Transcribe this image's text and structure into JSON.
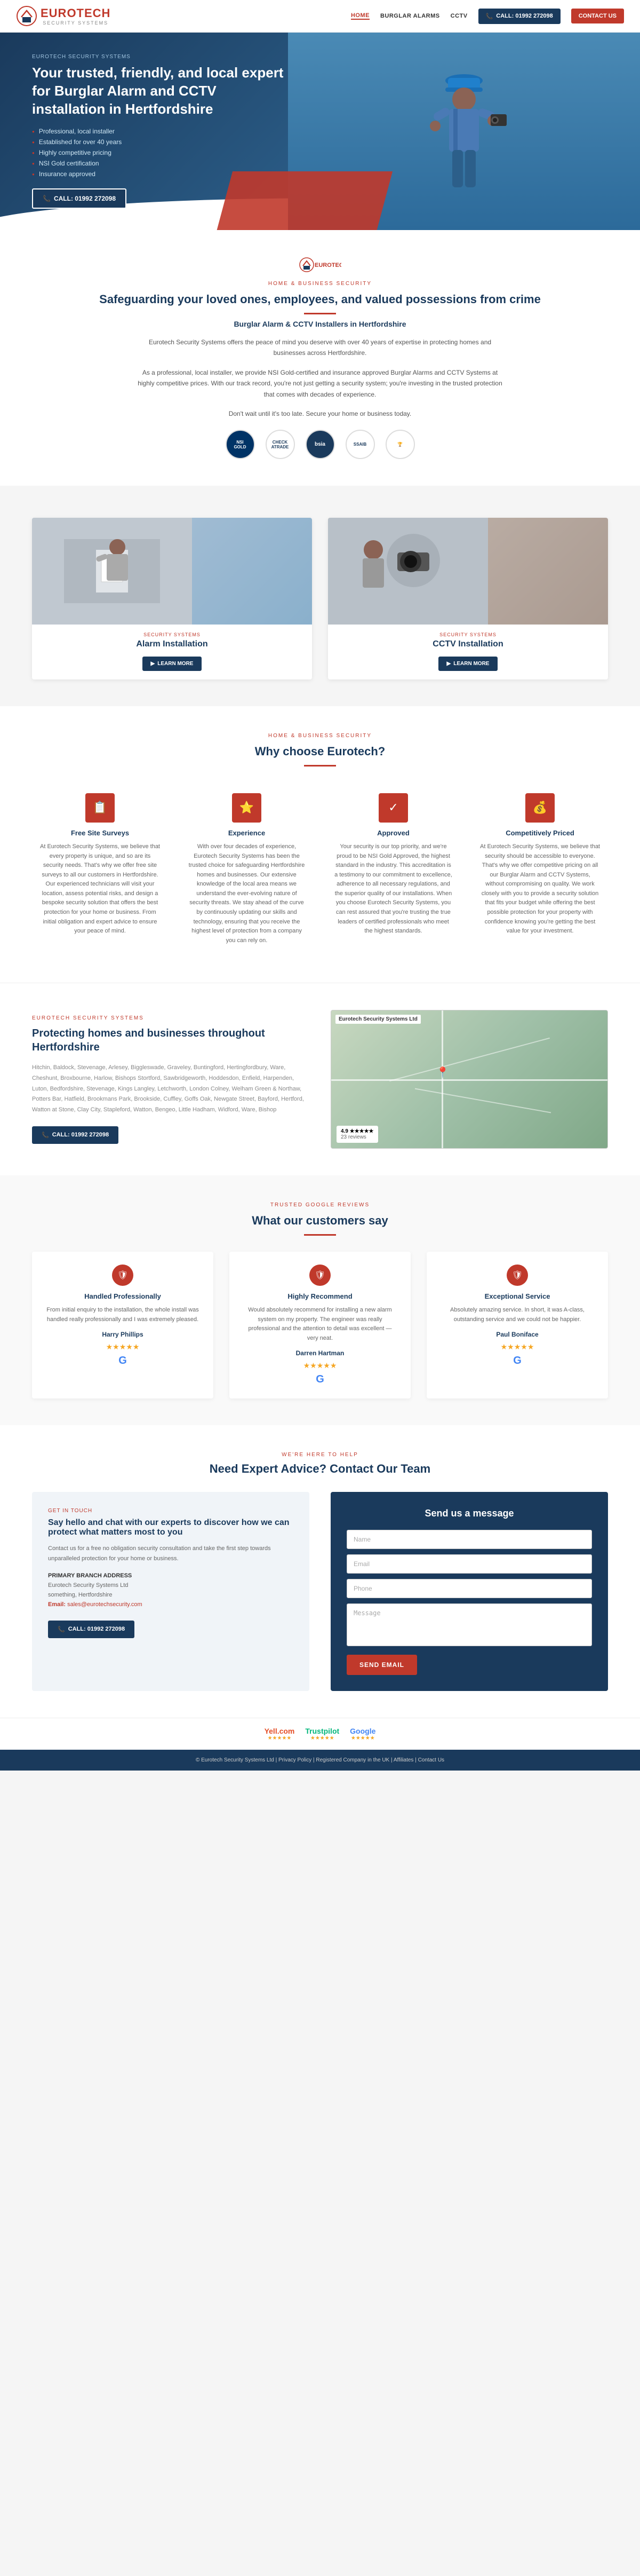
{
  "header": {
    "logo": "EUROTECH",
    "logo_tagline": "SECURITY SYSTEMS",
    "nav": {
      "home": "HOME",
      "burglar_alarms": "BURGLAR ALARMS",
      "cctv": "CCTV",
      "phone_label": "CALL: 01992 272098",
      "contact_label": "CONTACT US"
    }
  },
  "hero": {
    "label": "EUROTECH SECURITY SYSTEMS",
    "title": "Your trusted, friendly, and local expert for Burglar Alarm and CCTV installation in Hertfordshire",
    "features": [
      "Professional, local installer",
      "Established for over 40 years",
      "Highly competitive pricing",
      "NSI Gold certification",
      "Insurance approved"
    ],
    "cta": "CALL: 01992 272098"
  },
  "about": {
    "label": "HOME & BUSINESS SECURITY",
    "title": "Safeguarding your loved ones, employees, and valued possessions from crime",
    "subtitle": "Burglar Alarm & CCTV Installers in Hertfordshire",
    "text1": "Eurotech Security Systems offers the peace of mind you deserve with over 40 years of expertise in protecting homes and businesses across Hertfordshire.",
    "text2": "As a professional, local installer, we provide NSI Gold-certified and insurance approved Burglar Alarms and CCTV Systems at highly competitive prices. With our track record, you're not just getting a security system; you're investing in the trusted protection that comes with decades of experience.",
    "text3": "Don't wait until it's too late. Secure your home or business today."
  },
  "services": {
    "card1": {
      "label": "SECURITY SYSTEMS",
      "title": "Alarm Installation",
      "btn": "LEARN MORE"
    },
    "card2": {
      "label": "SECURITY SYSTEMS",
      "title": "CCTV Installation",
      "btn": "LEARN MORE"
    }
  },
  "why": {
    "label": "HOME & BUSINESS SECURITY",
    "title": "Why choose Eurotech?",
    "cards": [
      {
        "icon": "📋",
        "title": "Free Site Surveys",
        "text": "At Eurotech Security Systems, we believe that every property is unique, and so are its security needs. That's why we offer free site surveys to all our customers in Hertfordshire. Our experienced technicians will visit your location, assess potential risks, and design a bespoke security solution that offers the best protection for your home or business. From initial obligation and expert advice to ensure your peace of mind."
      },
      {
        "icon": "⭐",
        "title": "Experience",
        "text": "With over four decades of experience, Eurotech Security Systems has been the trusted choice for safeguarding Hertfordshire homes and businesses. Our extensive knowledge of the local area means we understand the ever-evolving nature of security threats. We stay ahead of the curve by continuously updating our skills and technology, ensuring that you receive the highest level of protection from a company you can rely on."
      },
      {
        "icon": "✓",
        "title": "Approved",
        "text": "Your security is our top priority, and we're proud to be NSI Gold Approved, the highest standard in the industry. This accreditation is a testimony to our commitment to excellence, adherence to all necessary regulations, and the superior quality of our installations. When you choose Eurotech Security Systems, you can rest assured that you're trusting the true leaders of certified professionals who meet the highest standards."
      },
      {
        "icon": "💰",
        "title": "Competitively Priced",
        "text": "At Eurotech Security Systems, we believe that security should be accessible to everyone. That's why we offer competitive pricing on all our Burglar Alarm and CCTV Systems, without compromising on quality. We work closely with you to provide a security solution that fits your budget while offering the best possible protection for your property with confidence knowing you're getting the best value for your investment."
      }
    ]
  },
  "locations": {
    "label": "EUROTECH SECURITY SYSTEMS",
    "title": "Protecting homes and businesses throughout Hertfordshire",
    "areas": "Hitchin, Baldock, Stevenage, Arlesey, Biggleswade, Graveley, Buntingford, Hertingfordbury, Ware, Cheshunt, Broxbourne, Harlow, Bishops Stortford, Sawbridgeworth, Hoddesdon, Enfield, Harpenden, Luton, Bedfordshire, Stevenage, Kings Langley, Letchworth, London Colney, Welham Green & Northaw, Potters Bar, Hatfield, Brookmans Park, Brookside, Cuffley, Goffs Oak, Newgate Street, Bayford, Hertford, Watton at Stone, Clay City, Stapleford, Watton, Bengeo, Little Hadham, Widford, Ware, Bishop",
    "btn": "CALL: 01992 272098",
    "map_title": "Eurotech Security Systems Ltd"
  },
  "reviews": {
    "label": "TRUSTED GOOGLE REVIEWS",
    "title": "What our customers say",
    "cards": [
      {
        "title": "Handled Professionally",
        "text": "From initial enquiry to the installation, the whole install was handled really professionally and I was extremely pleased.",
        "author": "Harry Phillips",
        "stars": "★★★★★"
      },
      {
        "title": "Highly Recommend",
        "text": "Would absolutely recommend for installing a new alarm system on my property. The engineer was really professional and the attention to detail was excellent — very neat.",
        "author": "Darren Hartman",
        "stars": "★★★★★"
      },
      {
        "title": "Exceptional Service",
        "text": "Absolutely amazing service. In short, it was A-class, outstanding service and we could not be happier.",
        "author": "Paul Boniface",
        "stars": "★★★★★"
      }
    ]
  },
  "contact": {
    "we_here_label": "WE'RE HERE TO HELP",
    "title": "Need Expert Advice? Contact Our Team",
    "left": {
      "label": "GET IN TOUCH",
      "title": "Say hello and chat with our experts to discover how we can protect what matters most to you",
      "text": "Contact us for a free no obligation security consultation and take the first step towards unparalleled protection for your home or business.",
      "address_label": "PRIMARY BRANCH ADDRESS",
      "address": "Eurotech Security Systems Ltd",
      "address2": "something, Hertfordshire",
      "email_label": "Email:",
      "email": "sales@eurotechsecurity.com",
      "phone": "CALL: 01992 272098"
    },
    "right": {
      "title": "Send us a message",
      "field1_placeholder": "Name",
      "field2_placeholder": "Email",
      "field3_placeholder": "Phone",
      "field4_placeholder": "Message",
      "btn": "SEND EMAIL"
    }
  },
  "trust_badges": {
    "items": [
      {
        "name": "Yell.com",
        "stars": "★★★★★"
      },
      {
        "name": "Trustpilot",
        "stars": "★★★★★"
      },
      {
        "name": "Google",
        "stars": "★★★★★"
      }
    ]
  },
  "footer": {
    "text": "© Eurotech Security Systems Ltd | Privacy Policy | Registered Company in the UK | Affiliates | Contact Us"
  }
}
